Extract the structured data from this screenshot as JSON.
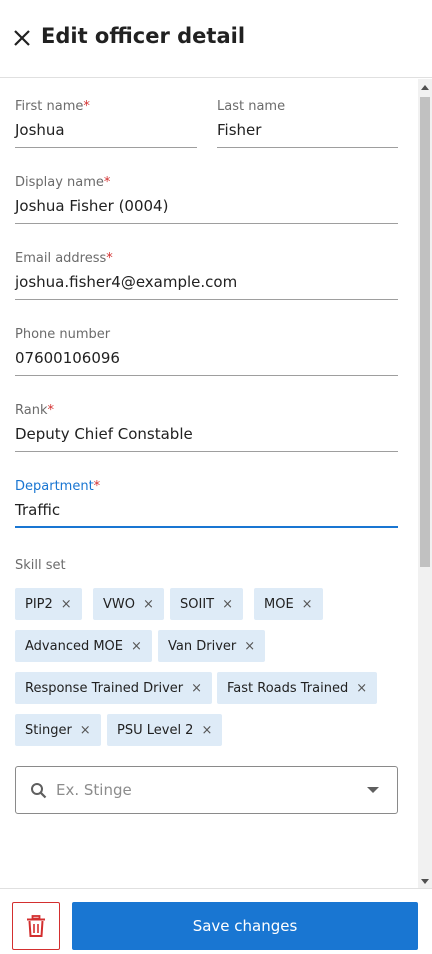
{
  "header": {
    "title": "Edit officer detail",
    "close_icon": "close-icon"
  },
  "form": {
    "first_name": {
      "label": "First name",
      "required": true,
      "value": "Joshua"
    },
    "last_name": {
      "label": "Last name",
      "required": false,
      "value": "Fisher"
    },
    "display_name": {
      "label": "Display name",
      "required": true,
      "value": "Joshua Fisher (0004)"
    },
    "email": {
      "label": "Email address",
      "required": true,
      "value": "joshua.fisher4@example.com"
    },
    "phone": {
      "label": "Phone number",
      "required": false,
      "value": "07600106096"
    },
    "rank": {
      "label": "Rank",
      "required": true,
      "value": "Deputy Chief Constable"
    },
    "department": {
      "label": "Department",
      "required": true,
      "value": "Traffic",
      "focused": true
    }
  },
  "skills": {
    "label": "Skill set",
    "chips": [
      "PIP2",
      "VWO",
      "SOIIT",
      "MOE",
      "Advanced MOE",
      "Van Driver",
      "Response Trained Driver",
      "Fast Roads Trained",
      "Stinger",
      "PSU Level 2"
    ],
    "remove_glyph": "×",
    "search": {
      "placeholder": "Ex. Stinge",
      "value": ""
    }
  },
  "footer": {
    "delete_icon": "trash-icon",
    "save_label": "Save changes"
  },
  "colors": {
    "accent": "#1976d2",
    "required": "#d32f2f",
    "chip_bg": "#deebf7",
    "delete_border": "#d32f2f"
  },
  "required_mark": "*"
}
